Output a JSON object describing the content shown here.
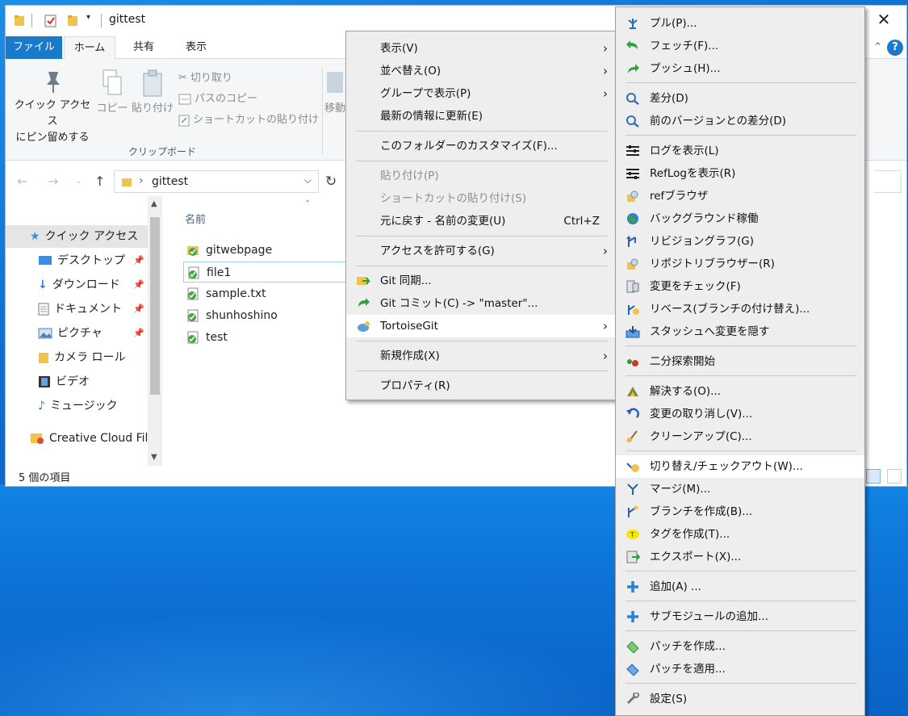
{
  "window": {
    "title": "gittest",
    "close_glyph": "✕"
  },
  "ribbon": {
    "tabs": [
      "ファイル",
      "ホーム",
      "共有",
      "表示"
    ],
    "pin_label_1": "クイック アクセス",
    "pin_label_2": "にピン留めする",
    "copy_label": "コピー",
    "paste_label": "貼り付け",
    "cut_label": "切り取り",
    "copy_path_label": "パスのコピー",
    "paste_shortcut_label": "ショートカットの貼り付け",
    "move_label": "移動",
    "group_label": "クリップボード"
  },
  "address": {
    "crumb": "gittest",
    "chevron": "›"
  },
  "nav": {
    "items": [
      {
        "label": "クイック アクセス",
        "icon": "star-icon"
      },
      {
        "label": "デスクトップ",
        "icon": "desktop-icon"
      },
      {
        "label": "ダウンロード",
        "icon": "download-icon"
      },
      {
        "label": "ドキュメント",
        "icon": "document-icon"
      },
      {
        "label": "ピクチャ",
        "icon": "picture-icon"
      },
      {
        "label": "カメラ ロール",
        "icon": "folder-icon"
      },
      {
        "label": "ビデオ",
        "icon": "video-icon"
      },
      {
        "label": "ミュージック",
        "icon": "music-icon"
      },
      {
        "label": "Creative Cloud Files",
        "icon": "creative-cloud-icon"
      }
    ]
  },
  "files": {
    "column_name": "名前",
    "rows": [
      "gitwebpage",
      "file1",
      "sample.txt",
      "shunhoshino",
      "test"
    ]
  },
  "status": {
    "count": "5 個の項目"
  },
  "context_menu": {
    "items": [
      {
        "label": "表示(V)",
        "arrow": true
      },
      {
        "label": "並べ替え(O)",
        "arrow": true
      },
      {
        "label": "グループで表示(P)",
        "arrow": true
      },
      {
        "label": "最新の情報に更新(E)"
      },
      {
        "label": "このフォルダーのカスタマイズ(F)..."
      },
      {
        "label": "貼り付け(P)",
        "disabled": true
      },
      {
        "label": "ショートカットの貼り付け(S)",
        "disabled": true
      },
      {
        "label": "元に戻す - 名前の変更(U)",
        "shortcut": "Ctrl+Z"
      },
      {
        "label": "アクセスを許可する(G)",
        "arrow": true
      },
      {
        "label": "Git 同期..."
      },
      {
        "label": "Git コミット(C) -> \"master\"..."
      },
      {
        "label": "TortoiseGit",
        "arrow": true
      },
      {
        "label": "新規作成(X)",
        "arrow": true
      },
      {
        "label": "プロパティ(R)"
      }
    ]
  },
  "tortoise_menu": {
    "items": [
      {
        "label": "プル(P)...",
        "icon": "pull-icon"
      },
      {
        "label": "フェッチ(F)...",
        "icon": "fetch-icon"
      },
      {
        "label": "プッシュ(H)...",
        "icon": "push-icon"
      },
      {
        "label": "差分(D)",
        "icon": "diff-icon"
      },
      {
        "label": "前のバージョンとの差分(D)",
        "icon": "diff-prev-icon"
      },
      {
        "label": "ログを表示(L)",
        "icon": "log-icon"
      },
      {
        "label": "RefLogを表示(R)",
        "icon": "reflog-icon"
      },
      {
        "label": "refブラウザ",
        "icon": "ref-browser-icon"
      },
      {
        "label": "バックグラウンド稼働",
        "icon": "daemon-icon"
      },
      {
        "label": "リビジョングラフ(G)",
        "icon": "revision-graph-icon"
      },
      {
        "label": "リポジトリブラウザー(R)",
        "icon": "repo-browser-icon"
      },
      {
        "label": "変更をチェック(F)",
        "icon": "check-modifications-icon"
      },
      {
        "label": "リベース(ブランチの付け替え)...",
        "icon": "rebase-icon"
      },
      {
        "label": "スタッシュへ変更を隠す",
        "icon": "stash-icon"
      },
      {
        "label": "二分探索開始",
        "icon": "bisect-icon"
      },
      {
        "label": "解決する(O)...",
        "icon": "resolve-icon"
      },
      {
        "label": "変更の取り消し(V)...",
        "icon": "revert-icon"
      },
      {
        "label": "クリーンアップ(C)...",
        "icon": "cleanup-icon"
      },
      {
        "label": "切り替え/チェックアウト(W)...",
        "icon": "switch-icon"
      },
      {
        "label": "マージ(M)...",
        "icon": "merge-icon"
      },
      {
        "label": "ブランチを作成(B)...",
        "icon": "branch-icon"
      },
      {
        "label": "タグを作成(T)...",
        "icon": "tag-icon"
      },
      {
        "label": "エクスポート(X)...",
        "icon": "export-icon"
      },
      {
        "label": "追加(A) ...",
        "icon": "add-icon"
      },
      {
        "label": "サブモジュールの追加...",
        "icon": "add-submodule-icon"
      },
      {
        "label": "パッチを作成...",
        "icon": "create-patch-icon"
      },
      {
        "label": "パッチを適用...",
        "icon": "apply-patch-icon"
      },
      {
        "label": "設定(S)",
        "icon": "settings-icon"
      }
    ]
  },
  "colors": {
    "accent": "#1979ca",
    "menu_bg": "#eeeeee",
    "desktop": "#0f6fd0"
  }
}
